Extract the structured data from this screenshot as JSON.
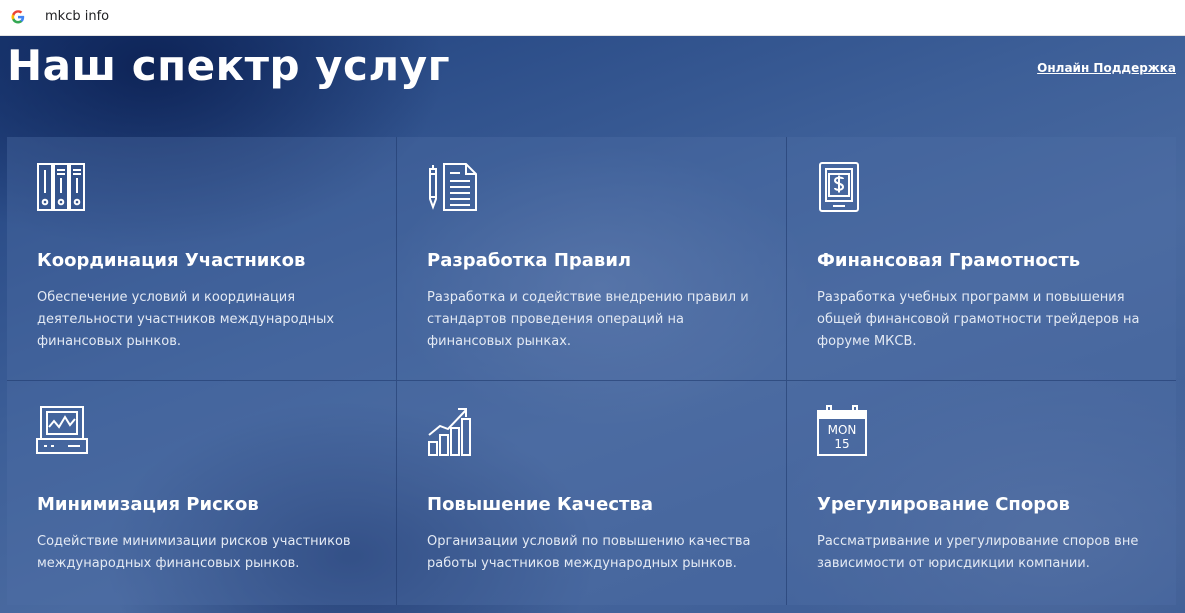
{
  "browser": {
    "logo_letter": "G",
    "query": "mkcb info"
  },
  "header": {
    "title": "Наш спектр услуг",
    "support_link": "Онлайн Поддержка"
  },
  "services": [
    {
      "icon": "binders-icon",
      "title": "Координация Участников",
      "description": "Обеспечение условий и координация деятельности участников международных финансовых рынков."
    },
    {
      "icon": "document-pen-icon",
      "title": "Разработка Правил",
      "description": "Разработка и содействие внедрению правил и стандартов проведения операций на финансовых рынках."
    },
    {
      "icon": "dollar-tablet-icon",
      "title": "Финансовая Грамотность",
      "description": "Разработка учебных программ и повышения общей финансовой грамотности трейдеров на форуме МКСВ."
    },
    {
      "icon": "monitor-chart-icon",
      "title": "Минимизация Рисков",
      "description": "Содействие минимизации рисков участников международных финансовых рынков."
    },
    {
      "icon": "growth-chart-icon",
      "title": "Повышение Качества",
      "description": "Организации условий по повышению качества работы участников международных рынков."
    },
    {
      "icon": "calendar-icon",
      "title": "Урегулирование Споров",
      "description": "Рассматривание и урегулирование споров вне зависимости от юрисдикции компании.",
      "calendar_day": "MON",
      "calendar_date": "15"
    }
  ]
}
